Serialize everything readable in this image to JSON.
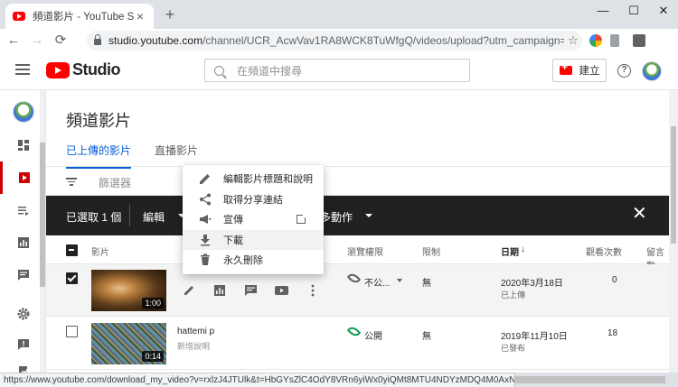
{
  "browser": {
    "tab_title": "頻道影片 - YouTube Studio",
    "tab_close": "×",
    "new_tab": "+",
    "window_minimize": "—",
    "window_maximize": "☐",
    "window_close": "✕",
    "back": "←",
    "forward": "→",
    "reload": "⟳",
    "url_host": "studio.youtube.com",
    "url_path": "/channel/UCR_AcwVav1RA8WCK8TuWfgQ/videos/upload?utm_campaign=upgrade&...",
    "bookmark_star": "☆",
    "status_url": "https://www.youtube.com/download_my_video?v=rxlzJ4JTUlk&t=HbGYsZlC4OdY8VRn6yiWx0yiQMt8MTU4NDYzMDQ4M0AxNTg0NTQ0MDgz"
  },
  "masthead": {
    "logo_text": "Studio",
    "search_placeholder": "在頻道中搜尋",
    "create_label": "建立",
    "help_label": "?"
  },
  "sidebar": {
    "items": [
      {
        "name": "dashboard-icon"
      },
      {
        "name": "videos-icon",
        "active": true
      },
      {
        "name": "playlists-icon"
      },
      {
        "name": "analytics-icon"
      },
      {
        "name": "comments-icon"
      },
      {
        "name": "settings-icon"
      },
      {
        "name": "feedback-icon"
      }
    ]
  },
  "page": {
    "title": "頻道影片",
    "tabs": [
      "已上傳的影片",
      "直播影片"
    ],
    "filter_label": "篩選器"
  },
  "action_bar": {
    "selected_label": "已選取 1 個",
    "edit_label": "編輯",
    "more_actions_label": "多動作",
    "close": "✕"
  },
  "table": {
    "headers": {
      "video": "影片",
      "visibility": "瀏覽權限",
      "restrictions": "限制",
      "date": "日期",
      "sort_arrow": "↓",
      "views": "觀看次數",
      "comments": "留言數"
    },
    "rows": [
      {
        "duration": "1:00",
        "visibility": "不公...",
        "restriction": "無",
        "date": "2020年3月18日",
        "date_status": "已上傳",
        "views": "0",
        "checked": true
      },
      {
        "title": "hattemi p",
        "subtitle": "新增說明",
        "duration": "0:14",
        "visibility": "公開",
        "restriction": "無",
        "date": "2019年11月10日",
        "date_status": "已發布",
        "views": "18",
        "checked": false
      }
    ]
  },
  "menu": {
    "items": [
      {
        "label": "編輯影片標題和說明",
        "icon": "pencil-icon"
      },
      {
        "label": "取得分享連結",
        "icon": "share-icon"
      },
      {
        "label": "宣傳",
        "icon": "megaphone-icon"
      },
      {
        "label": "下載",
        "icon": "download-icon"
      },
      {
        "label": "永久刪除",
        "icon": "trash-icon"
      }
    ]
  },
  "colors": {
    "accent_blue": "#065fd4",
    "brand_red": "#ff0000",
    "action_bar": "#212121",
    "public_green": "#0f9d58"
  }
}
